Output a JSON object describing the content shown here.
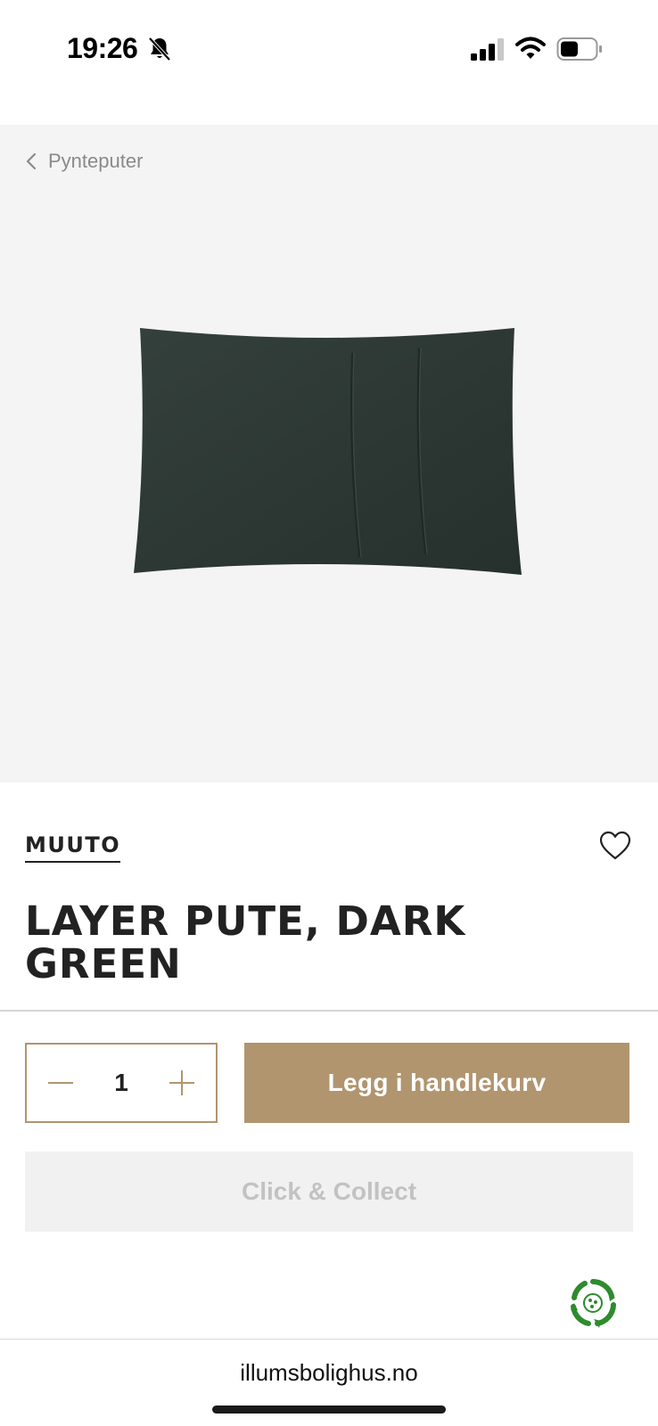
{
  "status_bar": {
    "time": "19:26",
    "icons": [
      "bell-muted-icon",
      "cellular-signal-icon",
      "wifi-icon",
      "battery-icon"
    ]
  },
  "breadcrumb": {
    "back_label": "Pynteputer"
  },
  "product": {
    "brand": "MUUTO",
    "title": "LAYER PUTE, DARK GREEN",
    "image_icon": "cushion-image",
    "image_color": "#2f3a36"
  },
  "purchase": {
    "quantity": "1",
    "add_to_cart_label": "Legg i handlekurv",
    "click_collect_label": "Click & Collect"
  },
  "browser": {
    "url": "illumsbolighus.no"
  },
  "colors": {
    "accent": "#b0956f",
    "image_background": "#f4f4f4",
    "disabled_button": "#f1f1f1",
    "eco_green": "#2e8b2e"
  }
}
